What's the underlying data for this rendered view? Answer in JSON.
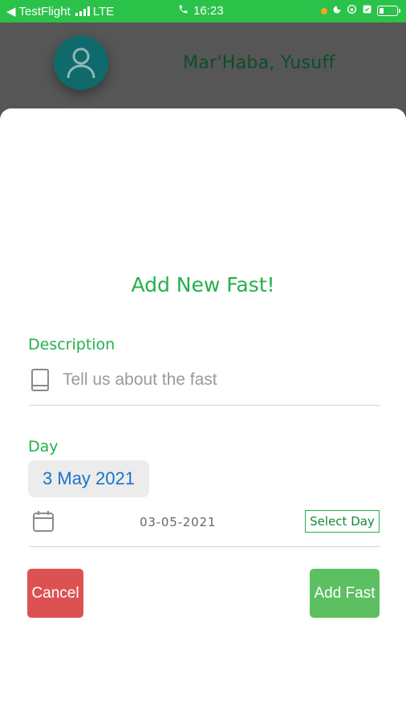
{
  "status_bar": {
    "back_app": "TestFlight",
    "network": "LTE",
    "time": "16:23"
  },
  "header": {
    "greeting": "Mar'Haba, Yusuff",
    "avatar_icon": "user-avatar-icon"
  },
  "sheet": {
    "title": "Add New Fast!",
    "description_label": "Description",
    "description_placeholder": "Tell us about the fast",
    "description_icon": "book-icon",
    "day_label": "Day",
    "selected_date": "3 May 2021",
    "date_value": "03-05-2021",
    "calendar_icon": "calendar-icon",
    "select_day_label": "Select Day",
    "cancel_label": "Cancel",
    "add_label": "Add Fast"
  },
  "colors": {
    "accent_green": "#22b14c",
    "status_bar": "#2bc24a",
    "cancel_red": "#dc5252",
    "add_green": "#5cbf60",
    "date_blue": "#1a73c9"
  }
}
